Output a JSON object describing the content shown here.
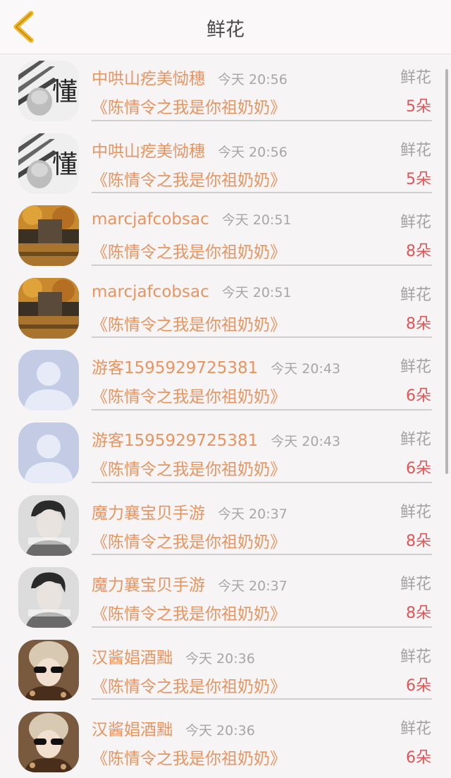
{
  "header": {
    "title": "鲜花",
    "back_icon": "chevron-left-icon"
  },
  "colors": {
    "accent": "#e8945f",
    "count": "#e05555",
    "back": "#f2b320"
  },
  "rows": [
    {
      "name": "中哄山疙美恸穗",
      "time": "今天 20:56",
      "type": "鲜花",
      "book": "《陈情令之我是你祖奶奶》",
      "count": "5朵",
      "avatar": "avatar-dong"
    },
    {
      "name": "中哄山疙美恸穗",
      "time": "今天 20:56",
      "type": "鲜花",
      "book": "《陈情令之我是你祖奶奶》",
      "count": "5朵",
      "avatar": "avatar-dong"
    },
    {
      "name": "marcjafcobsac",
      "time": "今天 20:51",
      "type": "鲜花",
      "book": "《陈情令之我是你祖奶奶》",
      "count": "8朵",
      "avatar": "avatar-autumn"
    },
    {
      "name": "marcjafcobsac",
      "time": "今天 20:51",
      "type": "鲜花",
      "book": "《陈情令之我是你祖奶奶》",
      "count": "8朵",
      "avatar": "avatar-autumn"
    },
    {
      "name": "游客1595929725381",
      "time": "今天 20:43",
      "type": "鲜花",
      "book": "《陈情令之我是你祖奶奶》",
      "count": "6朵",
      "avatar": "avatar-default"
    },
    {
      "name": "游客1595929725381",
      "time": "今天 20:43",
      "type": "鲜花",
      "book": "《陈情令之我是你祖奶奶》",
      "count": "6朵",
      "avatar": "avatar-default"
    },
    {
      "name": "魔力襄宝贝手游",
      "time": "今天 20:37",
      "type": "鲜花",
      "book": "《陈情令之我是你祖奶奶》",
      "count": "8朵",
      "avatar": "avatar-boy"
    },
    {
      "name": "魔力襄宝贝手游",
      "time": "今天 20:37",
      "type": "鲜花",
      "book": "《陈情令之我是你祖奶奶》",
      "count": "8朵",
      "avatar": "avatar-boy"
    },
    {
      "name": "汉酱娼酒黜",
      "time": "今天 20:36",
      "type": "鲜花",
      "book": "《陈情令之我是你祖奶奶》",
      "count": "6朵",
      "avatar": "avatar-sunglasses"
    },
    {
      "name": "汉酱娼酒黜",
      "time": "今天 20:36",
      "type": "鲜花",
      "book": "《陈情令之我是你祖奶奶》",
      "count": "6朵",
      "avatar": "avatar-sunglasses"
    }
  ]
}
